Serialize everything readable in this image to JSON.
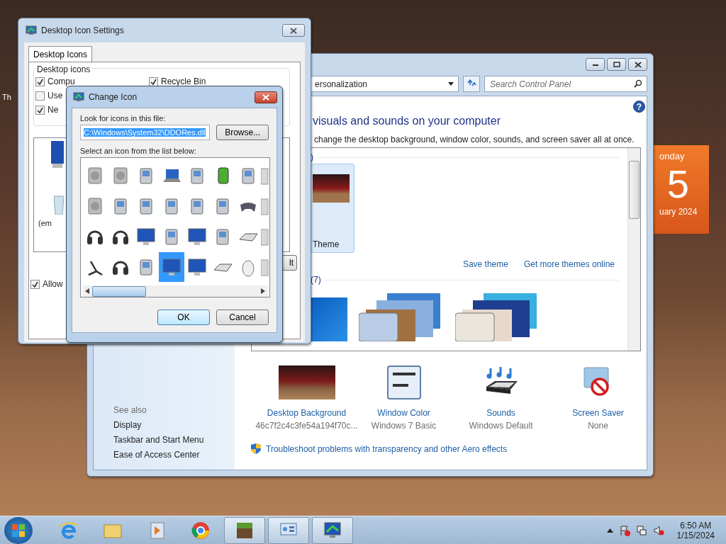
{
  "desktop": {
    "icon_label": "Th",
    "gadget": {
      "day": "onday",
      "date": "5",
      "month": "uary 2024"
    }
  },
  "personalization": {
    "help": "?",
    "address": "ersonalization",
    "search": {
      "placeholder": "Search Control Panel"
    },
    "heading": "visuals and sounds on your computer",
    "description": "change the desktop background, window color, sounds, and screen saver all at once.",
    "themes": {
      "group_1": ")",
      "theme": {
        "label": "Theme",
        "selected": true
      },
      "links": [
        "Save theme",
        "Get more themes online"
      ],
      "group_2": "(7)"
    },
    "see_also": {
      "title": "See also",
      "links": [
        "Display",
        "Taskbar and Start Menu",
        "Ease of Access Center"
      ]
    },
    "settings": [
      {
        "label": "Desktop Background",
        "value": "46c7f2c4c3fe54a194f70c..."
      },
      {
        "label": "Window Color",
        "value": "Windows 7 Basic"
      },
      {
        "label": "Sounds",
        "value": "Windows Default"
      },
      {
        "label": "Screen Saver",
        "value": "None"
      }
    ],
    "troubleshoot": "Troubleshoot problems with transparency and other Aero effects"
  },
  "desktop_icon_settings": {
    "title": "Desktop Icon Settings",
    "tab": {
      "label": "Desktop Icons",
      "selected": true
    },
    "group": "Desktop icons",
    "checkboxes": [
      {
        "label": "Compu",
        "checked": true
      },
      {
        "label": "Recycle Bin",
        "checked": true
      },
      {
        "label": "Use",
        "checked": false
      },
      {
        "label": "Ne",
        "checked": true
      }
    ],
    "icon_caption": "(em",
    "allow": {
      "label": "Allow",
      "checked": true
    },
    "button_fragment": "lt"
  },
  "change_icon": {
    "title": "Change Icon",
    "file_label": "Look for icons in this file:",
    "file_path": "C:\\Windows\\System32\\DDORes.dll",
    "browse": "Browse...",
    "list_label": "Select an icon from the list below:",
    "icons": [
      {
        "selected": false
      },
      {
        "selected": false
      },
      {
        "selected": false
      },
      {
        "selected": false
      },
      {
        "selected": false
      },
      {
        "selected": false
      },
      {
        "selected": false
      },
      {
        "selected": false
      },
      {
        "selected": false
      },
      {
        "selected": false
      },
      {
        "selected": false
      },
      {
        "selected": false
      },
      {
        "selected": false
      },
      {
        "selected": false
      },
      {
        "selected": false
      },
      {
        "selected": false
      },
      {
        "selected": false
      },
      {
        "selected": false
      },
      {
        "selected": false
      },
      {
        "selected": false
      },
      {
        "selected": false
      },
      {
        "selected": false
      },
      {
        "selected": false
      },
      {
        "selected": false
      },
      {
        "selected": false
      },
      {
        "selected": false
      },
      {
        "selected": false
      },
      {
        "selected": true
      },
      {
        "selected": false
      },
      {
        "selected": false
      },
      {
        "selected": false
      },
      {
        "selected": false
      }
    ],
    "buttons": [
      "OK",
      "Cancel"
    ]
  },
  "taskbar": {
    "apps": [
      {
        "running": false
      },
      {
        "running": false
      },
      {
        "running": false
      },
      {
        "running": false
      },
      {
        "running": true
      },
      {
        "running": true
      },
      {
        "running": true
      }
    ],
    "clock": {
      "time": "6:50 AM",
      "date": "1/15/2024"
    }
  }
}
